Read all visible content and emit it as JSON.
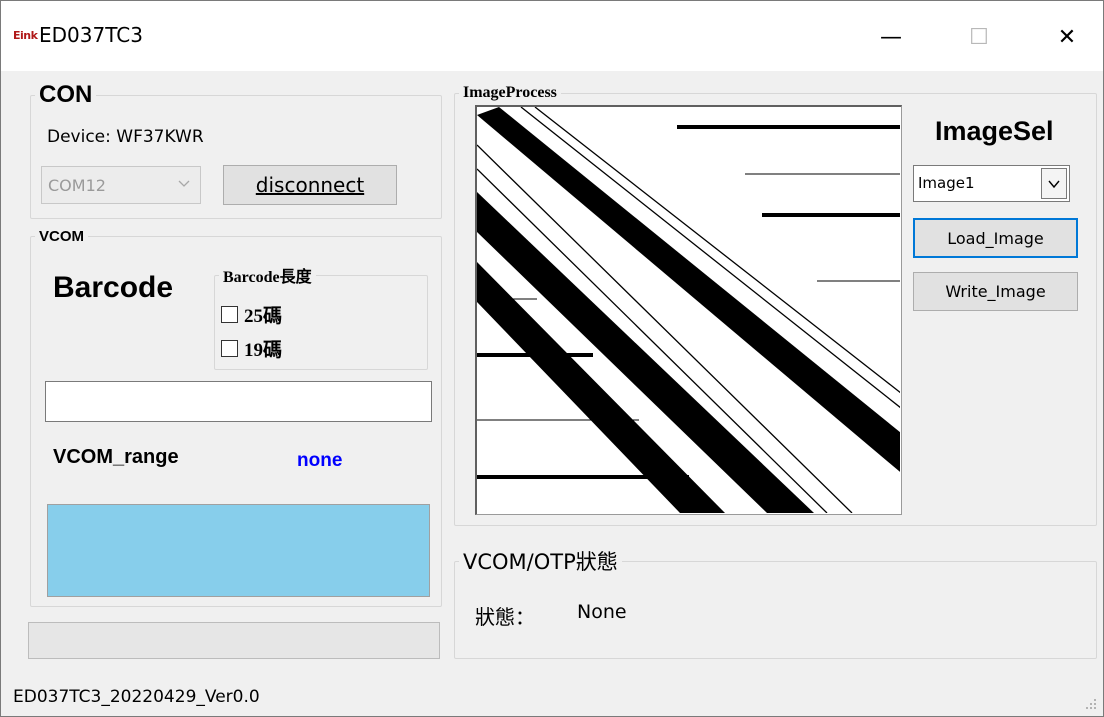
{
  "window": {
    "logo_text": "Eink",
    "title": "ED037TC3",
    "minimize_glyph": "—",
    "maximize_glyph": "☐",
    "close_glyph": "✕"
  },
  "con": {
    "legend": "CON",
    "device_text": "Device: WF37KWR",
    "port_value": "COM12",
    "disconnect_label": "disconnect"
  },
  "vcom": {
    "legend": "VCOM",
    "barcode_title": "Barcode",
    "barcode_length_legend": "Barcode長度",
    "option_25": "25碼",
    "option_19": "19碼",
    "barcode_input_value": "",
    "vcom_range_label": "VCOM_range",
    "vcom_range_value": "none",
    "color_box": "#87ceeb",
    "value_color": "#0000ff"
  },
  "image_process": {
    "legend": "ImageProcess",
    "imagesel_label": "ImageSel",
    "selected_image": "Image1",
    "load_label": "Load_Image",
    "write_label": "Write_Image"
  },
  "otp": {
    "legend": "VCOM/OTP狀態",
    "status_label": "狀態：",
    "status_value": "None"
  },
  "statusbar": {
    "text": "ED037TC3_20220429_Ver0.0"
  }
}
